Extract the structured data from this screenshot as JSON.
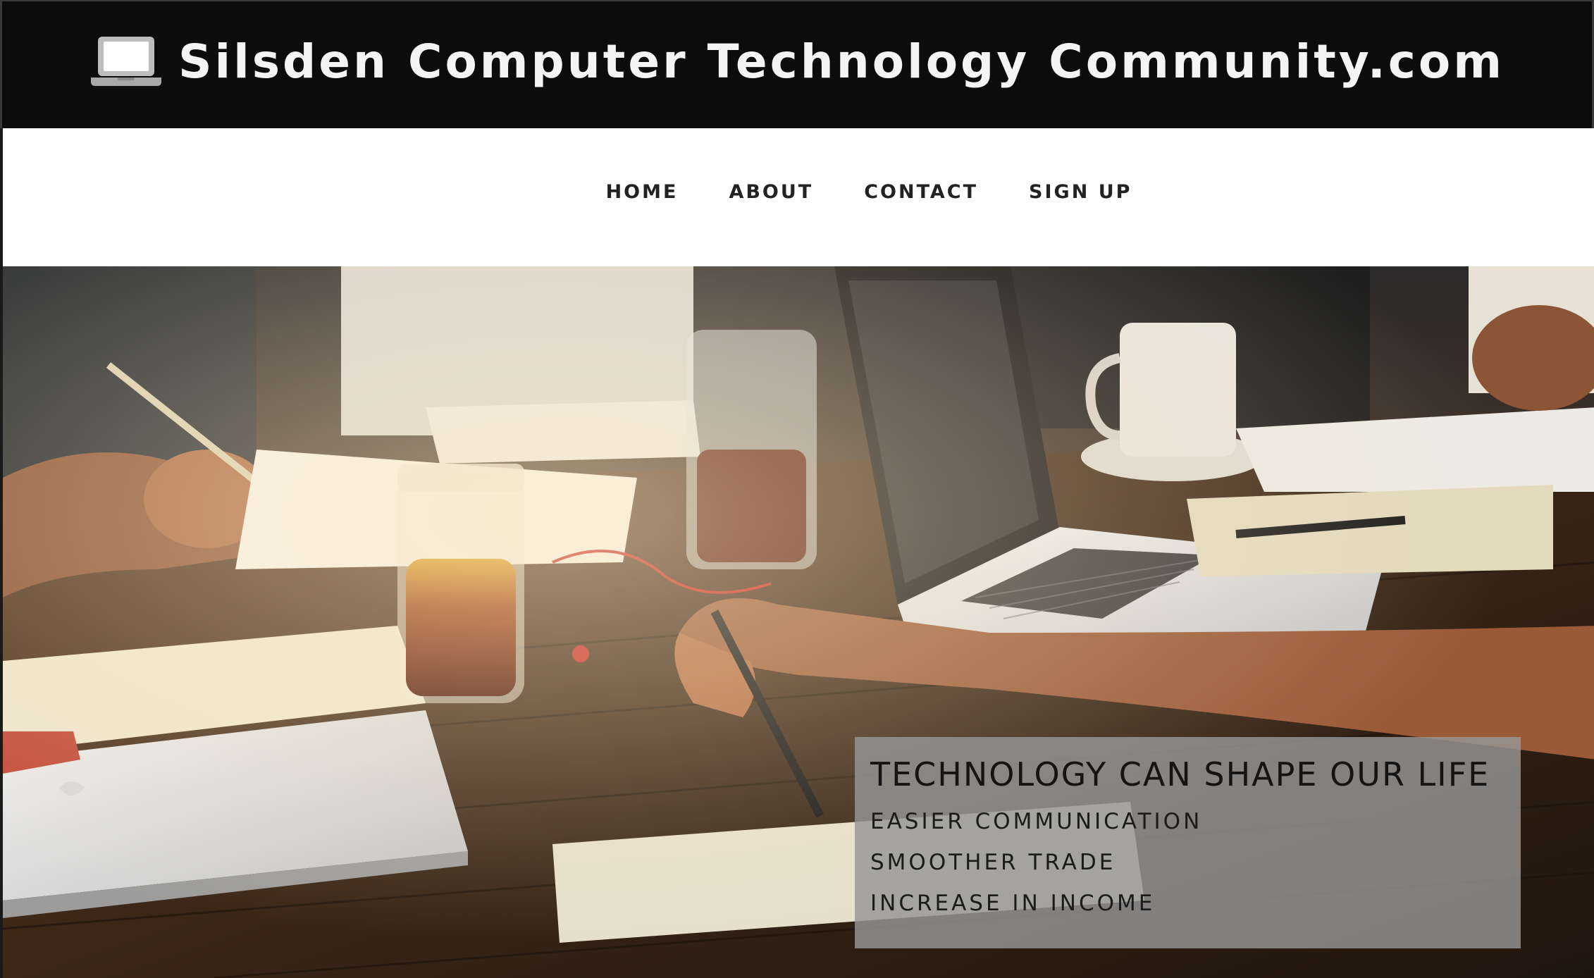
{
  "header": {
    "title": "Silsden Computer Technology Community.com",
    "logo_icon": "laptop-icon"
  },
  "nav": {
    "items": [
      {
        "label": "HOME"
      },
      {
        "label": "ABOUT"
      },
      {
        "label": "CONTACT"
      },
      {
        "label": "SIGN UP"
      }
    ]
  },
  "hero": {
    "image": "people-working-with-laptops-at-wooden-table",
    "caption": {
      "title": "TECHNOLOGY CAN SHAPE OUR LIFE",
      "lines": [
        "EASIER COMMUNICATION",
        "SMOOTHER TRADE",
        "INCREASE IN INCOME"
      ]
    }
  },
  "colors": {
    "header_bg": "#0c0c0c",
    "header_text": "#f4f4f4",
    "nav_text": "#222222",
    "caption_bg": "#969696"
  }
}
